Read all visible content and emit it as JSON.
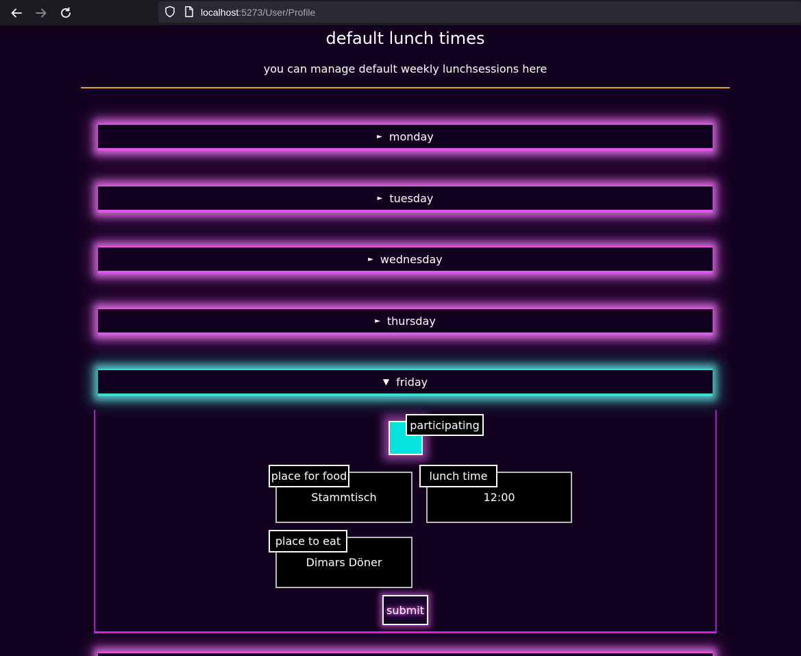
{
  "browser": {
    "url_host": "localhost",
    "url_rest": ":5273/User/Profile",
    "back_icon": "arrow-left-icon",
    "forward_icon": "arrow-right-icon",
    "reload_icon": "reload-icon"
  },
  "page": {
    "title": "default lunch times",
    "subtitle": "you can manage default weekly lunchsessions here"
  },
  "days": [
    {
      "label": "monday",
      "open": false
    },
    {
      "label": "tuesday",
      "open": false
    },
    {
      "label": "wednesday",
      "open": false
    },
    {
      "label": "thursday",
      "open": false
    },
    {
      "label": "friday",
      "open": true
    }
  ],
  "friday_form": {
    "participating_label": "participating",
    "participating_checked": true,
    "place_for_food_label": "place for food",
    "place_for_food_value": "Stammtisch",
    "lunch_time_label": "lunch time",
    "lunch_time_value": "12:00",
    "place_to_eat_label": "place to eat",
    "place_to_eat_value": "Dimars Döner",
    "submit_label": "submit"
  },
  "colors": {
    "background": "#12011f",
    "closed_accent": "#e055e6",
    "open_accent": "#3fdcd7",
    "divider": "#e1a43d",
    "checkbox_fill": "#05e3dc"
  }
}
